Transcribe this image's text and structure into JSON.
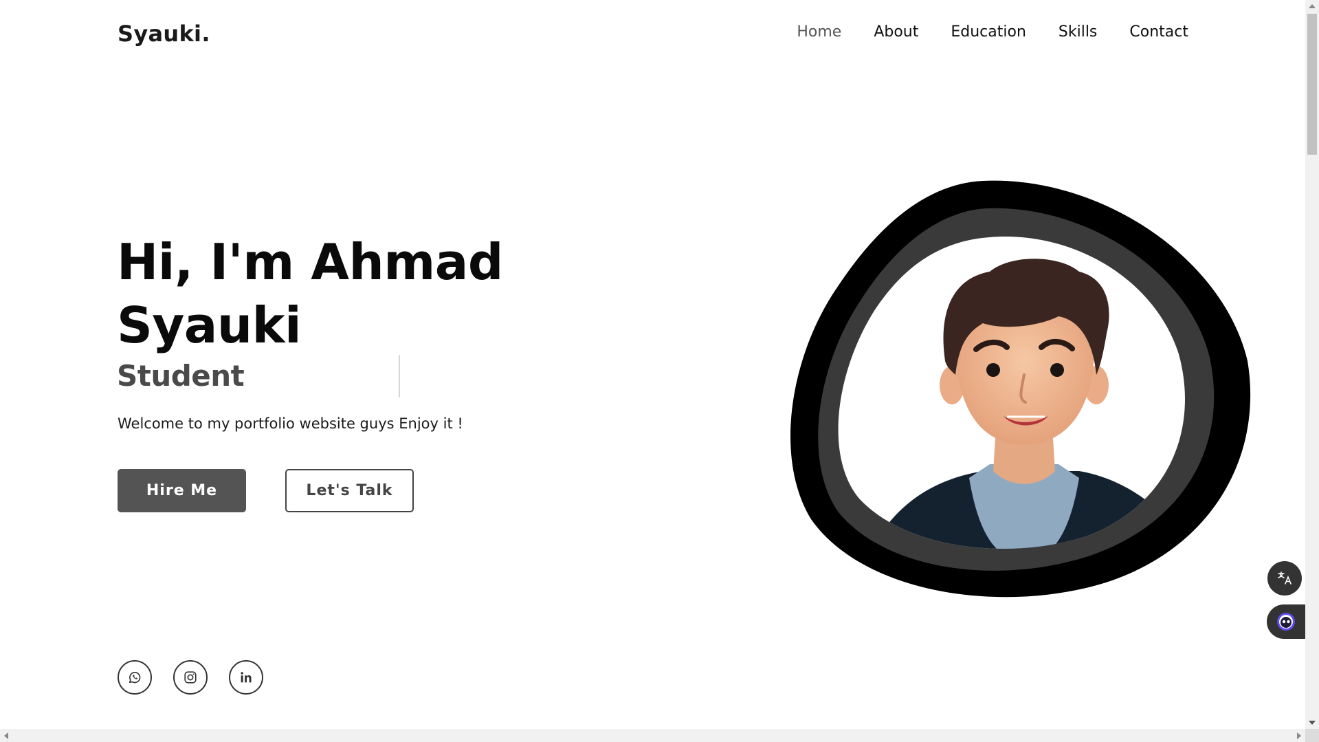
{
  "header": {
    "logo": "Syauki.",
    "nav": [
      {
        "label": "Home",
        "active": true
      },
      {
        "label": "About"
      },
      {
        "label": "Education"
      },
      {
        "label": "Skills"
      },
      {
        "label": "Contact"
      }
    ]
  },
  "hero": {
    "title_line1": "Hi, I'm Ahmad",
    "title_line2": "Syauki",
    "role": "Student",
    "description": "Welcome to my portfolio website guys Enjoy it !",
    "hire_label": "Hire Me",
    "talk_label": "Let's Talk"
  },
  "socials": [
    {
      "icon": "whatsapp-icon"
    },
    {
      "icon": "instagram-icon"
    },
    {
      "icon": "linkedin-icon"
    }
  ],
  "colors": {
    "accent": "#545454",
    "text": "#111111",
    "blob_outer": "#000000",
    "blob_inner": "#3a3a3a"
  }
}
